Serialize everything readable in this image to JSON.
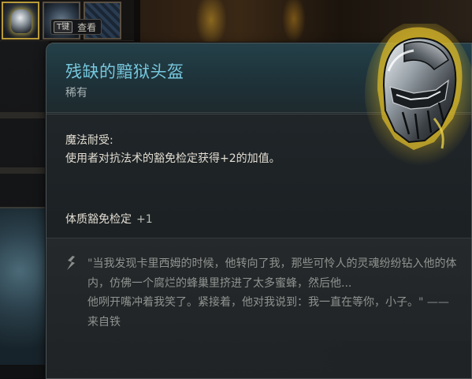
{
  "key_hint": {
    "key": "T键",
    "label": "查看"
  },
  "item": {
    "name": "残缺的黯狱头盔",
    "rarity": "稀有",
    "icon": "helmet-icon"
  },
  "effect": {
    "title": "魔法耐受:",
    "description": "使用者对抗法术的豁免检定获得+2的加值。"
  },
  "save": {
    "label": "体质豁免检定",
    "bonus": "+1"
  },
  "flavor": {
    "text": "\"当我发现卡里西姆的时候，他转向了我，那些可怜人的灵魂纷纷钻入他的体内，仿佛一个腐烂的蜂巢里挤进了太多蜜蜂，然后他...\n他咧开嘴冲着我笑了。紧接着，他对我说到：我一直在等你，小子。\" —— 来自铁"
  },
  "colors": {
    "item_name": "#76c8de",
    "header_bg": "#244049",
    "body_text": "#e2ddd2",
    "flavor_text": "#8f938f"
  }
}
